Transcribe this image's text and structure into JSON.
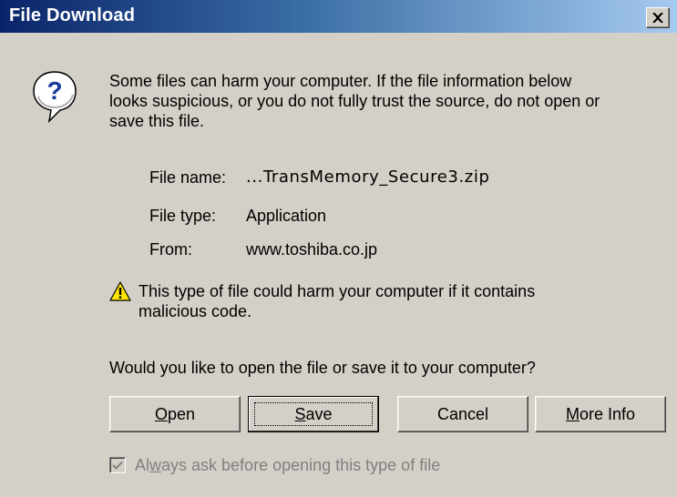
{
  "window": {
    "title": "File Download",
    "close_symbol": "×"
  },
  "icons": {
    "question": "question-icon",
    "warning": "warning-icon",
    "close": "close-icon",
    "check": "check-icon"
  },
  "message": {
    "line1": "Some files can harm your computer. If the file information below",
    "line2": "looks suspicious, or you do not fully trust the source, do not open or",
    "line3": "save this file."
  },
  "file_info": {
    "name_label": "File name:",
    "name_value": "...TransMemory_Secure3.zip",
    "type_label": "File type:",
    "type_value": "Application",
    "from_label": "From:",
    "from_value": "www.toshiba.co.jp"
  },
  "caution": {
    "line1": "This type of file could harm your computer if it contains",
    "line2": "malicious code."
  },
  "prompt": "Would you like to open the file or save it to your computer?",
  "buttons": {
    "open": {
      "mnemonic": "O",
      "rest": "pen"
    },
    "save": {
      "mnemonic": "S",
      "rest": "ave"
    },
    "cancel": "Cancel",
    "more_info": {
      "mnemonic": "M",
      "rest": "ore Info"
    }
  },
  "checkbox": {
    "checked": true,
    "label_pre": "Al",
    "label_mnemonic": "w",
    "label_post": "ays ask before opening this type of file"
  },
  "colors": {
    "face": "#d4d0c8",
    "title_start": "#0a246a",
    "title_end": "#a6caf0",
    "disabled_text": "#808080"
  }
}
